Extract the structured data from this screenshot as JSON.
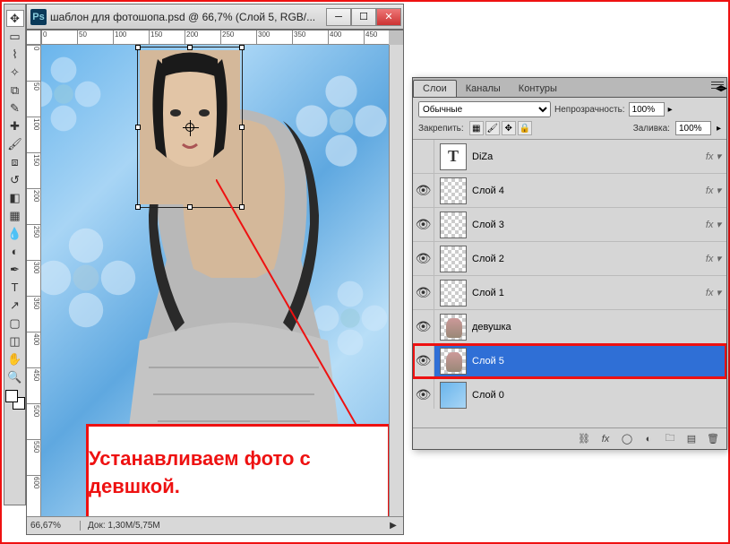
{
  "window": {
    "title": "шаблон для фотошопа.psd @ 66,7% (Слой 5, RGB/..."
  },
  "rulers_h": [
    "0",
    "50",
    "100",
    "150",
    "200",
    "250",
    "300",
    "350",
    "400",
    "450"
  ],
  "rulers_v": [
    "0",
    "50",
    "100",
    "150",
    "200",
    "250",
    "300",
    "350",
    "400",
    "450",
    "500",
    "550",
    "600"
  ],
  "callout_text": "Устанавливаем фото с девшкой.",
  "status": {
    "zoom": "66,67%",
    "doc": "Док: 1,30M/5,75M"
  },
  "panel": {
    "tabs": [
      "Слои",
      "Каналы",
      "Контуры"
    ],
    "active_tab": 0,
    "blend_mode": "Обычные",
    "opacity_label": "Непрозрачность:",
    "opacity_value": "100%",
    "lock_label": "Закрепить:",
    "fill_label": "Заливка:",
    "fill_value": "100%"
  },
  "layers": [
    {
      "name": "DiZa",
      "visible": false,
      "thumb": "text",
      "fx": true
    },
    {
      "name": "Слой 4",
      "visible": true,
      "thumb": "checker",
      "fx": true
    },
    {
      "name": "Слой 3",
      "visible": true,
      "thumb": "checker",
      "fx": true
    },
    {
      "name": "Слой 2",
      "visible": true,
      "thumb": "checker",
      "fx": true
    },
    {
      "name": "Слой 1",
      "visible": true,
      "thumb": "checker",
      "fx": true
    },
    {
      "name": "девушка",
      "visible": true,
      "thumb": "girl",
      "fx": false
    },
    {
      "name": "Слой 5",
      "visible": true,
      "thumb": "girl",
      "fx": false,
      "selected": true
    },
    {
      "name": "Слой 0",
      "visible": true,
      "thumb": "blue",
      "fx": false
    }
  ]
}
